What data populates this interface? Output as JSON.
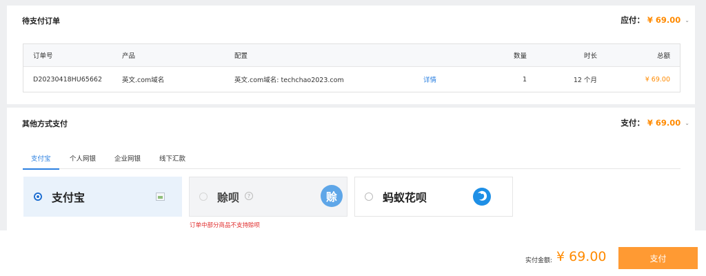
{
  "order_section": {
    "title": "待支付订单",
    "amount_label": "应付：",
    "amount_value": "¥ 69.00",
    "columns": [
      "订单号",
      "产品",
      "配置",
      "数量",
      "时长",
      "总额"
    ],
    "rows": [
      {
        "order_no": "D20230418HU65662",
        "product": "英文.com域名",
        "config": "英文.com域名: techchao2023.com",
        "detail": "详情",
        "quantity": "1",
        "duration": "12 个月",
        "total": "¥ 69.00"
      }
    ]
  },
  "other_section": {
    "title": "其他方式支付",
    "amount_label": "支付：",
    "amount_value": "¥ 69.00",
    "tabs": [
      "支付宝",
      "个人网银",
      "企业网银",
      "线下汇款"
    ],
    "active_tab": 0,
    "methods": [
      {
        "label": "支付宝",
        "state": "selected"
      },
      {
        "label": "赊呗",
        "state": "disabled",
        "logo_text": "赊"
      },
      {
        "label": "蚂蚁花呗",
        "state": "normal"
      }
    ],
    "warning": "订单中部分商品不支持赊呗"
  },
  "footer": {
    "pay_amount_label": "实付金额:",
    "pay_amount": "¥ 69.00",
    "pay_button": "支付"
  },
  "colors": {
    "accent_orange": "#ff8a00",
    "link_blue": "#2a7fe0",
    "pay_button": "#ff9a33",
    "warning_red": "#e02b2b"
  },
  "icons": {
    "collapse": "chevron-down-icon",
    "help": "question-circle-icon"
  }
}
